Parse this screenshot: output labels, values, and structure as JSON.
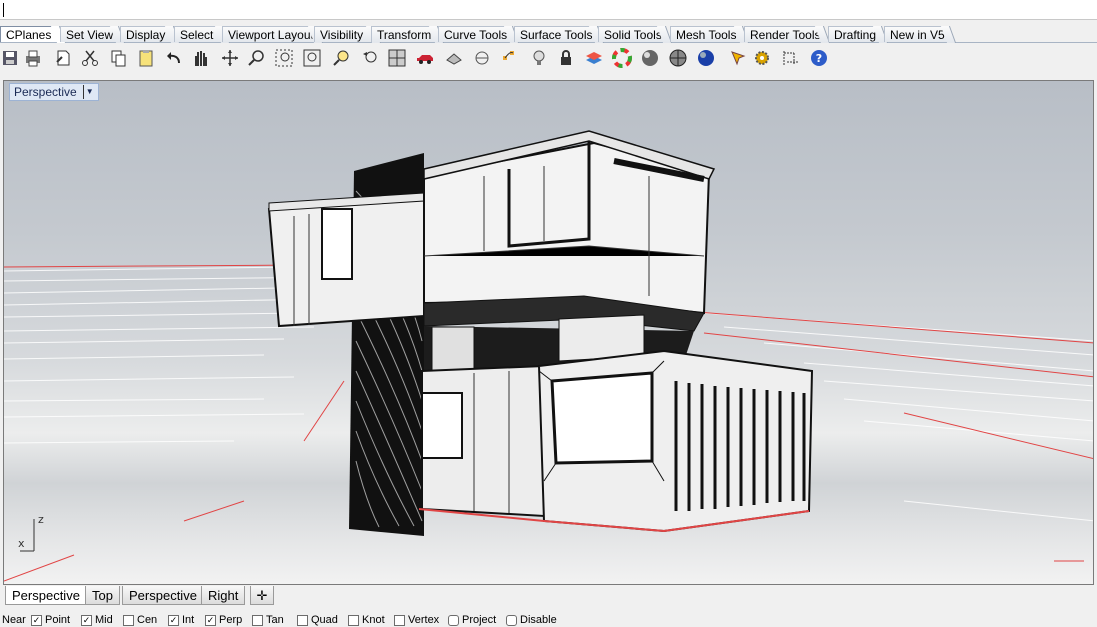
{
  "toolbar_tabs": [
    "CPlanes",
    "Set View",
    "Display",
    "Select",
    "Viewport Layout",
    "Visibility",
    "Transform",
    "Curve Tools",
    "Surface Tools",
    "Solid Tools",
    "Mesh Tools",
    "Render Tools",
    "Drafting",
    "New in V5"
  ],
  "toolbar_icons": [
    "save-icon",
    "print-icon",
    "import-icon",
    "cut-icon",
    "copy-icon",
    "paste-icon",
    "undo-icon",
    "pan-hand-icon",
    "rotate-view-icon",
    "zoom-icon",
    "zoom-window-icon",
    "zoom-extents-icon",
    "zoom-selected-icon",
    "undo-view-icon",
    "four-viewports-icon",
    "car-icon",
    "object-properties-icon",
    "options-icon",
    "points-on-icon",
    "light-bulb-icon",
    "lock-icon",
    "layer-icon",
    "color-wheel-icon",
    "shaded-sphere-icon",
    "rendered-sphere-icon",
    "blue-sphere-icon",
    "render-icon",
    "gear-icon",
    "dimension-icon",
    "help-icon"
  ],
  "viewport": {
    "title": "Perspective",
    "axis_z": "z",
    "axis_x": "x"
  },
  "viewport_tabs": [
    "Perspective",
    "Top",
    "Perspective",
    "Right"
  ],
  "add_viewport_icon": "plus-icon",
  "osnap": {
    "near": {
      "label": "Near",
      "checked": false
    },
    "items": [
      {
        "label": "Point",
        "checked": true
      },
      {
        "label": "Mid",
        "checked": true
      },
      {
        "label": "Cen",
        "checked": false
      },
      {
        "label": "Int",
        "checked": true
      },
      {
        "label": "Perp",
        "checked": true
      },
      {
        "label": "Tan",
        "checked": false
      },
      {
        "label": "Quad",
        "checked": false
      },
      {
        "label": "Knot",
        "checked": false
      },
      {
        "label": "Vertex",
        "checked": false
      },
      {
        "label": "Project",
        "checked": false
      },
      {
        "label": "Disable",
        "checked": false
      }
    ]
  },
  "colors": {
    "accent": "#1a2a55",
    "edge": "#d94040"
  }
}
